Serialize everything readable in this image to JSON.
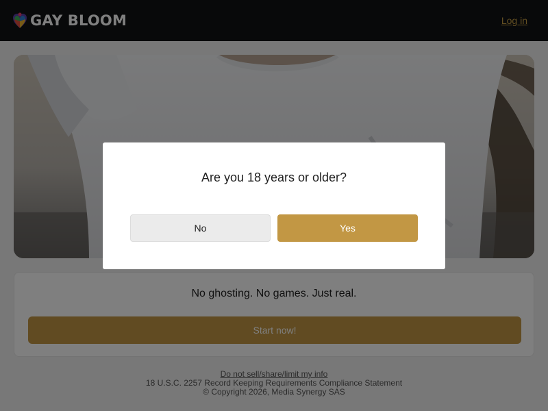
{
  "header": {
    "brand": "GAY BLOOM",
    "login_label": "Log in"
  },
  "hero": {
    "image": "photo-man-white-shirt-beach"
  },
  "card": {
    "tagline": "No ghosting. No games. Just real.",
    "cta_label": "Start now!"
  },
  "footer": {
    "privacy_link": "Do not sell/share/limit my info",
    "compliance": "18 U.S.C. 2257 Record Keeping Requirements Compliance Statement",
    "copyright": "© Copyright 2026, Media Synergy SAS"
  },
  "modal": {
    "question": "Are you 18 years or older?",
    "no_label": "No",
    "yes_label": "Yes"
  },
  "colors": {
    "header_bg": "#111215",
    "accent": "#c29744",
    "link": "#c69e44"
  }
}
